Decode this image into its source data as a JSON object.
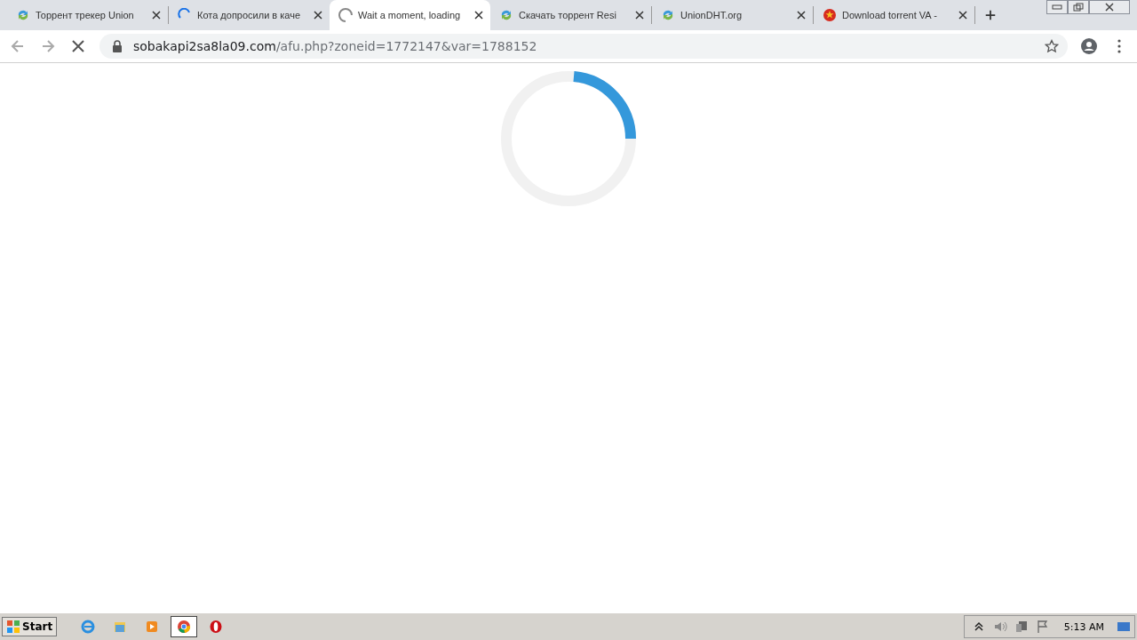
{
  "tabs": [
    {
      "title": "Торрент трекер Union",
      "kind": "sync",
      "selected": false
    },
    {
      "title": "Кота допросили в каче",
      "kind": "loading",
      "selected": false
    },
    {
      "title": "Wait a moment, loading",
      "kind": "loading-grey",
      "selected": true
    },
    {
      "title": "Скачать торрент Resi",
      "kind": "sync",
      "selected": false
    },
    {
      "title": "UnionDHT.org",
      "kind": "sync",
      "selected": false
    },
    {
      "title": "Download torrent VA -",
      "kind": "emblem",
      "selected": false
    }
  ],
  "address": {
    "host": "sobakapi2sa8la09.com",
    "path": "/afu.php?zoneid=1772147&var=1788152"
  },
  "taskbar": {
    "start": "Start",
    "apps": [
      {
        "kind": "ie",
        "selected": false
      },
      {
        "kind": "folder",
        "selected": false
      },
      {
        "kind": "media",
        "selected": false
      },
      {
        "kind": "chrome",
        "selected": true
      },
      {
        "kind": "opera",
        "selected": false
      }
    ],
    "clock": "5:13 AM"
  }
}
